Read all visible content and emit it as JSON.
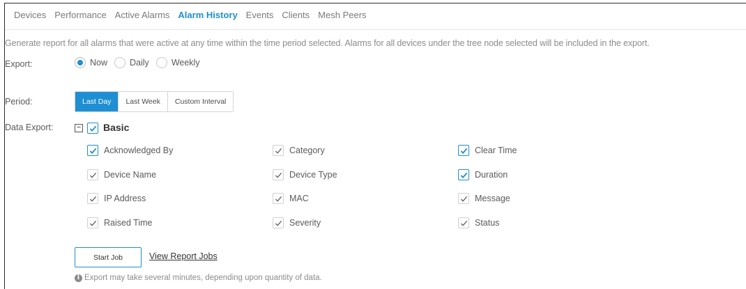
{
  "tabs": [
    {
      "label": "Devices"
    },
    {
      "label": "Performance"
    },
    {
      "label": "Active Alarms"
    },
    {
      "label": "Alarm History",
      "active": true
    },
    {
      "label": "Events"
    },
    {
      "label": "Clients"
    },
    {
      "label": "Mesh Peers"
    }
  ],
  "description": "Generate report for all alarms that were active at any time within the time period selected. Alarms for all devices under the tree node selected will be included in the export.",
  "export": {
    "label": "Export:",
    "options": [
      {
        "label": "Now",
        "selected": true
      },
      {
        "label": "Daily",
        "selected": false
      },
      {
        "label": "Weekly",
        "selected": false
      }
    ]
  },
  "period": {
    "label": "Period:",
    "options": [
      {
        "label": "Last Day",
        "active": true
      },
      {
        "label": "Last Week",
        "active": false
      },
      {
        "label": "Custom Interval",
        "active": false
      }
    ]
  },
  "data_export": {
    "label": "Data Export:",
    "toggle_glyph": "−",
    "group_label": "Basic",
    "fields": [
      {
        "label": "Acknowledged By",
        "checked": true,
        "style": "blue"
      },
      {
        "label": "Category",
        "checked": true,
        "style": "grey"
      },
      {
        "label": "Clear Time",
        "checked": true,
        "style": "blue"
      },
      {
        "label": "Device Name",
        "checked": true,
        "style": "grey"
      },
      {
        "label": "Device Type",
        "checked": true,
        "style": "grey"
      },
      {
        "label": "Duration",
        "checked": true,
        "style": "blue"
      },
      {
        "label": "IP Address",
        "checked": true,
        "style": "grey"
      },
      {
        "label": "MAC",
        "checked": true,
        "style": "grey"
      },
      {
        "label": "Message",
        "checked": true,
        "style": "grey"
      },
      {
        "label": "Raised Time",
        "checked": true,
        "style": "grey"
      },
      {
        "label": "Severity",
        "checked": true,
        "style": "grey"
      },
      {
        "label": "Status",
        "checked": true,
        "style": "grey"
      }
    ]
  },
  "actions": {
    "start_job": "Start Job",
    "view_report_jobs": "View Report Jobs"
  },
  "note": {
    "icon": "info-icon",
    "icon_glyph": "i",
    "text": "Export may take several minutes, depending upon quantity of data."
  },
  "colors": {
    "accent": "#1e8fd3",
    "text": "#4a4a4a",
    "muted": "#8c8c8c"
  }
}
